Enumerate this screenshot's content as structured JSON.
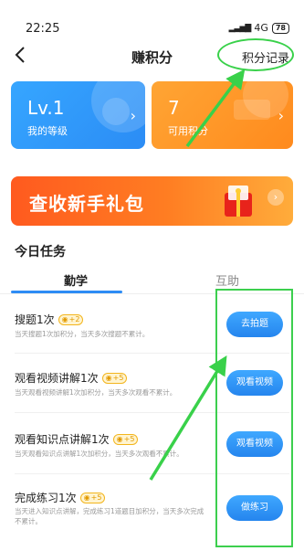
{
  "status_bar": {
    "time": "22:25",
    "network": "4G",
    "battery": "78"
  },
  "nav": {
    "title": "赚积分",
    "record_label": "积分记录"
  },
  "cards": {
    "level": {
      "value": "Lv.1",
      "label": "我的等级"
    },
    "points": {
      "value": "7",
      "label": "可用积分"
    }
  },
  "banner": {
    "title": "查收新手礼包"
  },
  "tasks_section": {
    "title": "今日任务",
    "tabs": [
      {
        "label": "勤学",
        "active": true
      },
      {
        "label": "互助",
        "active": false
      }
    ]
  },
  "tasks": [
    {
      "name": "搜题1次",
      "badge": "+2",
      "desc": "当天搜题1次加积分，当天多次搜题不累计。",
      "button": "去拍题"
    },
    {
      "name": "观看视频讲解1次",
      "badge": "+5",
      "desc": "当天观看视频讲解1次加积分，当天多次观看不累计。",
      "button": "观看视频"
    },
    {
      "name": "观看知识点讲解1次",
      "badge": "+5",
      "desc": "当天观看知识点讲解1次加积分，当天多次观看不累计。",
      "button": "观看视频"
    },
    {
      "name": "完成练习1次",
      "badge": "+5",
      "desc": "当天进入知识点讲解，完成练习1道题目加积分，当天多次完成不累计。",
      "button": "做练习"
    }
  ],
  "colors": {
    "primary_blue": "#2e8cf5",
    "orange": "#ff8a1d",
    "annotation_green": "#39d14a"
  }
}
